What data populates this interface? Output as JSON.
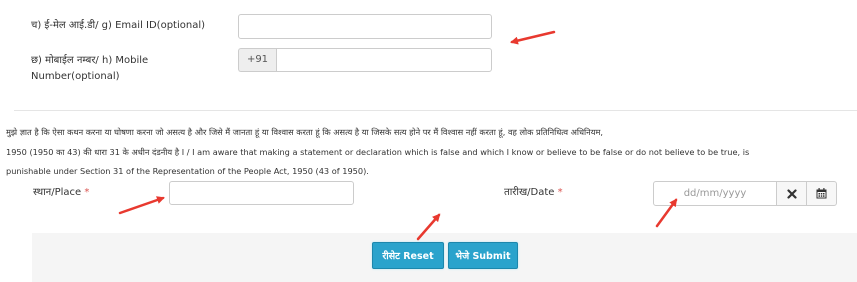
{
  "email": {
    "label": "च) ई-मेल आई.डी/ g) Email ID(optional)",
    "value": ""
  },
  "mobile": {
    "label_line1": "छ) मोबाईल नम्बर/ h) Mobile",
    "label_line2": "Number(optional)",
    "prefix": "+91",
    "value": ""
  },
  "declaration": {
    "line1": "मुझे ज्ञात है कि ऐसा कथन करना या घोषणा करना जो असत्य है और जिसे मैं जानता हूं या विश्वास करता हूं कि असत्य है या जिसके सत्य होने पर मैं विश्वास नहीं करता हूं, वह लोक प्रतिनिधित्व अधिनियम,",
    "line2": "1950 (1950 का 43) की धारा 31 के अधीन दंडनीय है I / I am aware that making a statement or declaration which is false and which I know or believe to be false or do not believe to be true, is",
    "line3": "punishable under Section 31 of the Representation of the People Act, 1950 (43 of 1950)."
  },
  "place": {
    "label": "स्थान/Place",
    "required_mark": "*",
    "value": ""
  },
  "date": {
    "label": "तारीख/Date",
    "required_mark": "*",
    "placeholder": "dd/mm/yyyy",
    "clear_icon": "close-icon",
    "calendar_icon": "calendar-icon"
  },
  "buttons": {
    "reset_label": "रीसेट Reset",
    "submit_label": "भेजे Submit"
  },
  "annotations": {
    "arrow_color": "#e8392f"
  }
}
